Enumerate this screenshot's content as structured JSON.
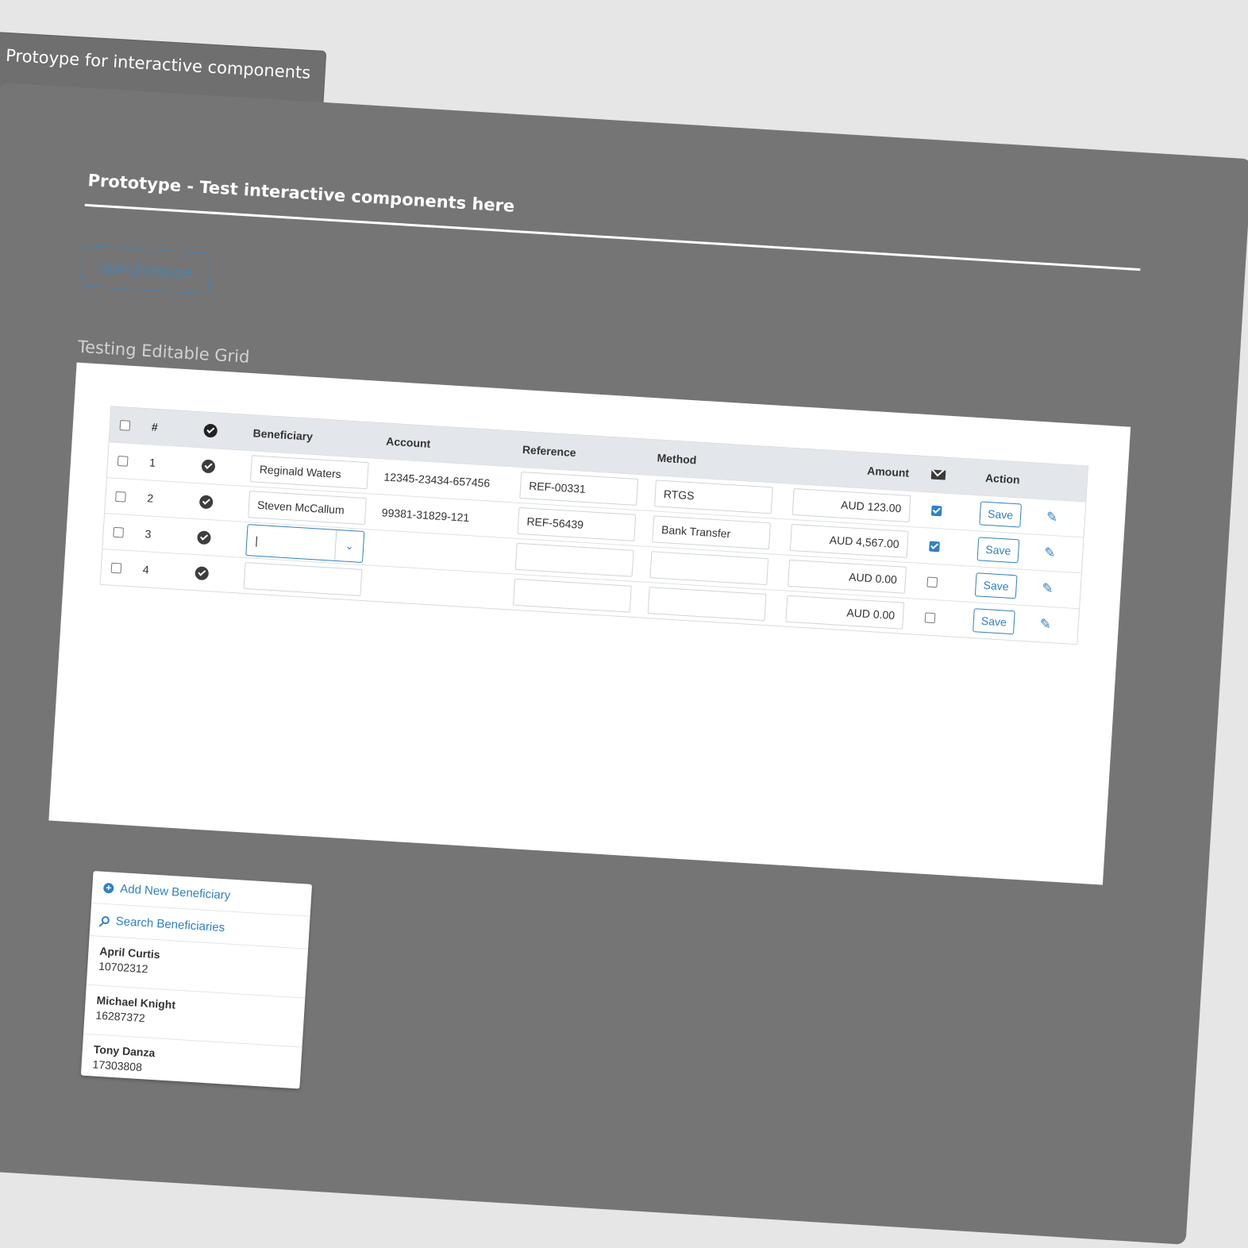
{
  "tab_title": "Protoype for interactive components",
  "board": {
    "title": "Prototype - Test interactive components here",
    "open_button": "Open Prototype",
    "section_title": "Testing Editable Grid"
  },
  "grid": {
    "headers": {
      "num": "#",
      "beneficiary": "Beneficiary",
      "account": "Account",
      "reference": "Reference",
      "method": "Method",
      "amount": "Amount",
      "action": "Action"
    },
    "rows": [
      {
        "num": "1",
        "beneficiary": "Reginald Waters",
        "account": "12345-23434-657456",
        "reference": "REF-00331",
        "method": "RTGS",
        "amount": "AUD 123.00",
        "notify": true,
        "save": "Save"
      },
      {
        "num": "2",
        "beneficiary": "Steven McCallum",
        "account": "99381-31829-121",
        "reference": "REF-56439",
        "method": "Bank Transfer",
        "amount": "AUD 4,567.00",
        "notify": true,
        "save": "Save"
      },
      {
        "num": "3",
        "beneficiary": "|",
        "account": "",
        "reference": "",
        "method": "",
        "amount": "AUD 0.00",
        "notify": false,
        "save": "Save"
      },
      {
        "num": "4",
        "beneficiary": "",
        "account": "",
        "reference": "",
        "method": "",
        "amount": "AUD 0.00",
        "notify": false,
        "save": "Save"
      }
    ]
  },
  "dropdown": {
    "add_label": "Add New Beneficiary",
    "search_label": "Search Beneficiaries",
    "items": [
      {
        "name": "April Curtis",
        "number": "10702312"
      },
      {
        "name": "Michael Knight",
        "number": "16287372"
      },
      {
        "name": "Tony Danza",
        "number": "17303808"
      }
    ]
  },
  "colors": {
    "accent": "#2f80c4",
    "board": "#757575",
    "background": "#e6e6e6"
  }
}
